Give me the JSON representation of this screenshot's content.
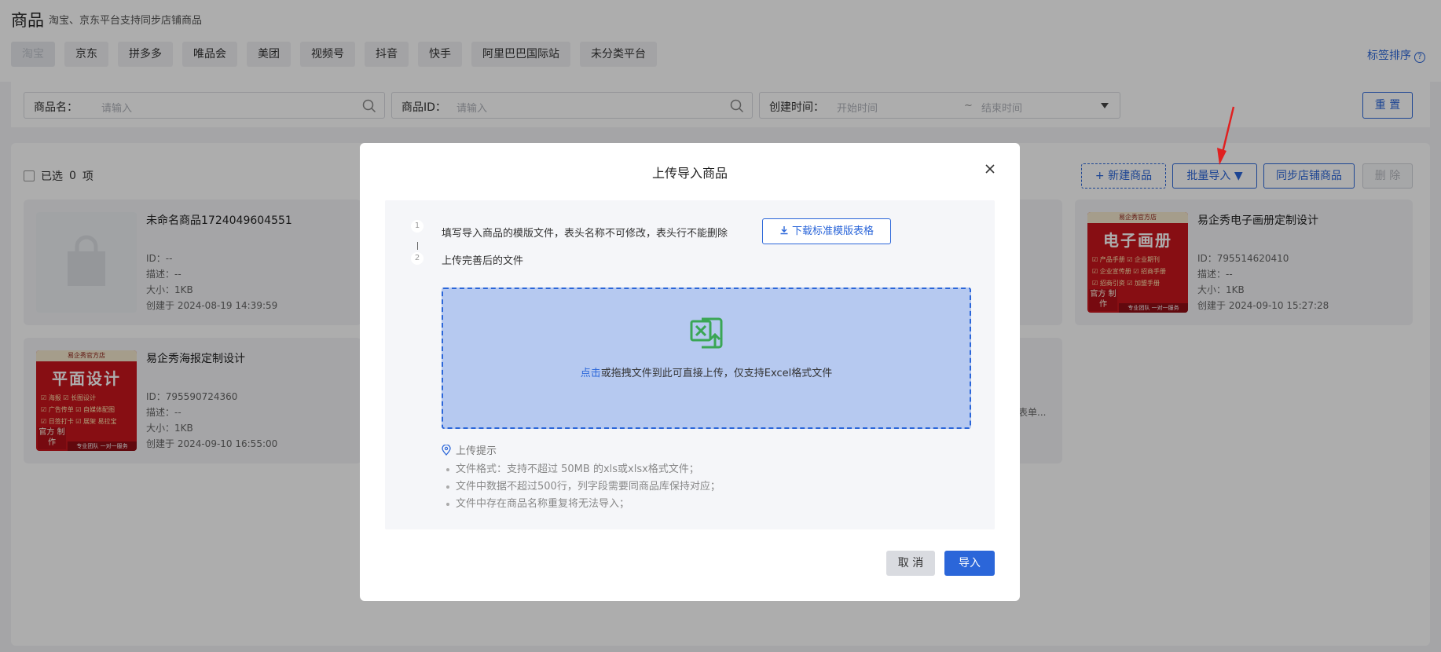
{
  "header": {
    "title": "商品",
    "subtitle": "淘宝、京东平台支持同步店铺商品",
    "tabs": [
      "淘宝",
      "京东",
      "拼多多",
      "唯品会",
      "美团",
      "视频号",
      "抖音",
      "快手",
      "阿里巴巴国际站",
      "未分类平台"
    ],
    "active_tab": "淘宝",
    "sort_label": "标签排序",
    "help_icon": "question-circle-icon"
  },
  "filters": {
    "name_label": "商品名：",
    "name_placeholder": "请输入",
    "id_label": "商品ID：",
    "id_placeholder": "请输入",
    "time_label": "创建时间：",
    "start_placeholder": "开始时间",
    "sep": "~",
    "end_placeholder": "结束时间",
    "reset_label": "重 置"
  },
  "toolbar": {
    "selected_text": "已选",
    "selected_count": "0",
    "selected_unit": "项",
    "new_label": "新建商品",
    "batch_import_label": "批量导入",
    "sync_label": "同步店铺商品",
    "delete_label": "删 除"
  },
  "cards": [
    {
      "name": "未命名商品1724049604551",
      "id": "ID：--",
      "desc": "描述：--",
      "size": "大小：1KB",
      "created": "创建于 2024-08-19 14:39:59"
    },
    {
      "name": "易企秀电子画册定制设计",
      "id": "ID：795514620410",
      "desc": "描述：--",
      "size": "大小：1KB",
      "created": "创建于 2024-09-10 15:27:28",
      "thumb_title": "电子画册",
      "thumb_top": "易企秀官方店",
      "thumb_lines": [
        "☑ 产品手册 ☑ 企业期刊",
        "☑ 企业宣传册 ☑ 招商手册",
        "☑ 招商引资 ☑ 加盟手册"
      ],
      "thumb_badge": "官方 制作",
      "thumb_strip": "专业团队 一对一服务"
    },
    {
      "name": "易企秀海报定制设计",
      "id": "ID：795590724360",
      "desc": "描述：--",
      "size": "大小：1KB",
      "created": "创建于 2024-09-10 16:55:00",
      "thumb_title": "平面设计",
      "thumb_top": "易企秀官方店",
      "thumb_lines": [
        "☑ 海报 ☑ 长图设计",
        "☑ 广告传单 ☑ 自媒体配图",
        "☑ 日签打卡 ☑ 展架 易拉宝"
      ],
      "thumb_badge": "官方 制作",
      "thumb_strip": "专业团队 一对一服务"
    }
  ],
  "hidden_card_snippet": "表单...",
  "modal": {
    "title": "上传导入商品",
    "step1_num": "1",
    "step1_text": "填写导入商品的模版文件，表头名称不可修改，表头行不能删除",
    "download_label": "下载标准模版表格",
    "step2_num": "2",
    "step2_text": "上传完善后的文件",
    "drop_link": "点击",
    "drop_text": "或拖拽文件到此可直接上传，仅支持Excel格式文件",
    "tips_title": "上传提示",
    "tips": [
      "文件格式：支持不超过 50MB 的xls或xlsx格式文件；",
      "文件中数据不超过500行，列字段需要同商品库保持对应；",
      "文件中存在商品名称重复将无法导入；"
    ],
    "cancel_label": "取 消",
    "ok_label": "导入"
  },
  "colors": {
    "primary": "#2b66d9",
    "excel_green": "#3aa655",
    "annotation_red": "#e02020"
  }
}
